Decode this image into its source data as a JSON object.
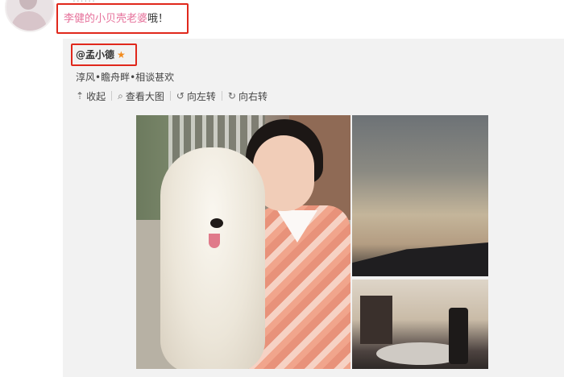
{
  "post": {
    "top_name_fragment": "......",
    "caption_link": "李健的小贝壳老婆",
    "caption_tail": "哦！"
  },
  "repost": {
    "author": "@孟小德",
    "tagline": "淳风•瞻舟畔•相谈甚欢",
    "toolbar": [
      {
        "icon": "collect-icon",
        "glyph": "⇡",
        "label": "收起"
      },
      {
        "icon": "zoom-icon",
        "glyph": "⌕",
        "label": "查看大图"
      },
      {
        "icon": "rotate-left-icon",
        "glyph": "↺",
        "label": "向左转"
      },
      {
        "icon": "rotate-right-icon",
        "glyph": "↻",
        "label": "向右转"
      }
    ]
  },
  "colors": {
    "highlight_box": "#e0281c",
    "link": "#e6709a",
    "star": "#f28b1e",
    "card_bg": "#f2f2f2"
  }
}
